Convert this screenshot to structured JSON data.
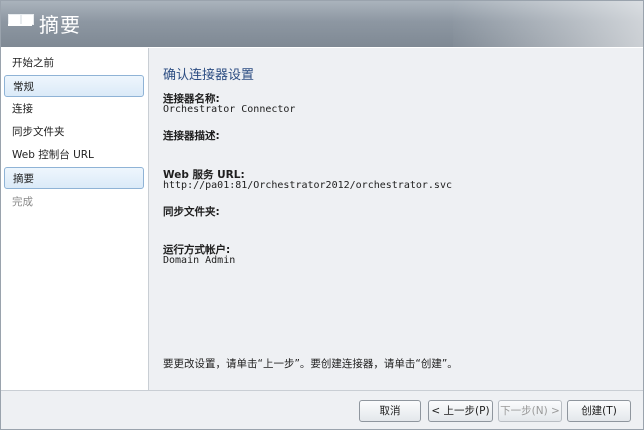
{
  "header": {
    "title": "摘要",
    "icon": "wizard-icon"
  },
  "sidebar": {
    "items": [
      {
        "label": "开始之前",
        "state": "normal"
      },
      {
        "label": "常规",
        "state": "selected"
      },
      {
        "label": "连接",
        "state": "normal"
      },
      {
        "label": "同步文件夹",
        "state": "normal"
      },
      {
        "label": "Web 控制台 URL",
        "state": "normal"
      },
      {
        "label": "摘要",
        "state": "selected"
      },
      {
        "label": "完成",
        "state": "disabled"
      }
    ]
  },
  "main": {
    "title": "确认连接器设置",
    "fields": [
      {
        "label": "连接器名称:",
        "value": "Orchestrator Connector"
      },
      {
        "label": "连接器描述:",
        "value": ""
      },
      {
        "label": "Web 服务 URL:",
        "value": "http://pa01:81/Orchestrator2012/orchestrator.svc"
      },
      {
        "label": "同步文件夹:",
        "value": ""
      },
      {
        "label": "运行方式帐户:",
        "value": "Domain Admin"
      }
    ],
    "note": "要更改设置，请单击“上一步”。要创建连接器，请单击“创建”。"
  },
  "buttons": {
    "cancel": "取消",
    "previous": "< 上一步(P)",
    "next": "下一步(N) >",
    "create": "创建(T)"
  },
  "colors": {
    "title_blue": "#2c4d82",
    "header_gray": "#8d97a2",
    "selected_bg": "#dbeaf8"
  }
}
